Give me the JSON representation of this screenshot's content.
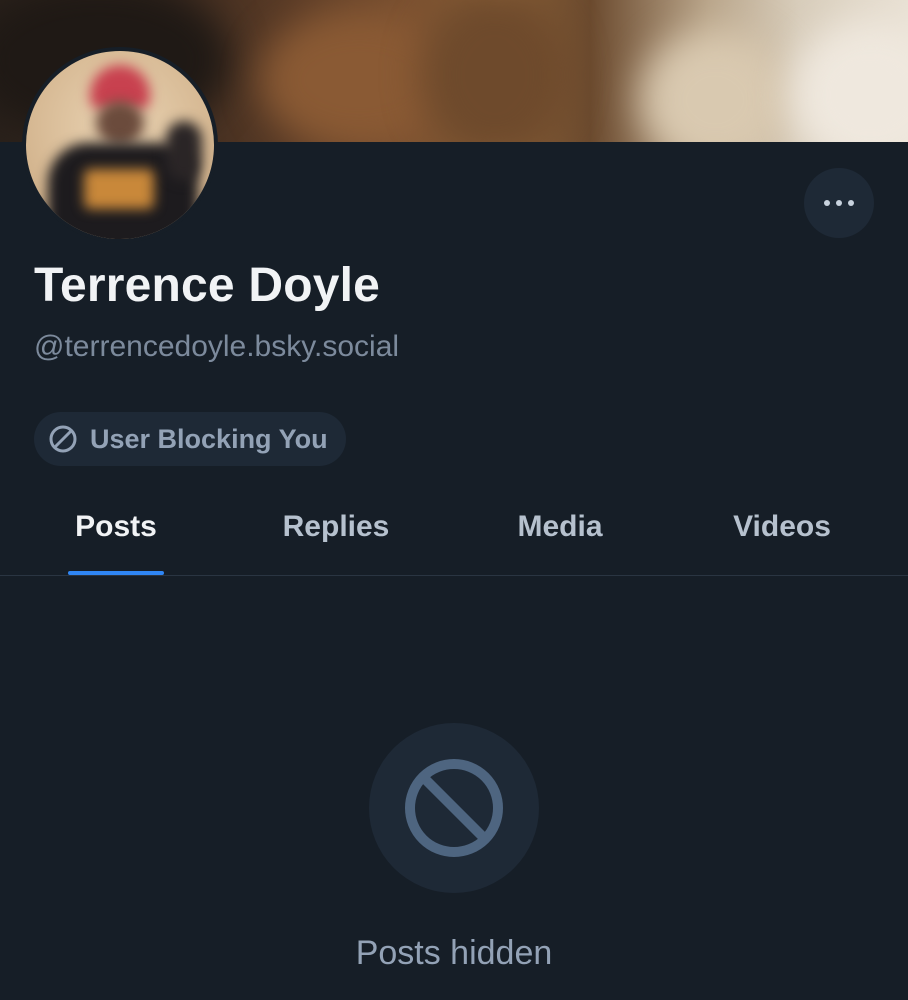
{
  "profile": {
    "display_name": "Terrence Doyle",
    "handle": "@terrencedoyle.bsky.social"
  },
  "block_status": {
    "label": "User Blocking You",
    "icon": "block-icon"
  },
  "more_button": {
    "icon": "ellipsis-icon"
  },
  "tabs": [
    {
      "label": "Posts",
      "active": true
    },
    {
      "label": "Replies",
      "active": false
    },
    {
      "label": "Media",
      "active": false
    },
    {
      "label": "Videos",
      "active": false
    }
  ],
  "empty_state": {
    "icon": "block-icon",
    "message": "Posts hidden"
  },
  "colors": {
    "background": "#161e27",
    "accent": "#2f86f5",
    "muted_text": "#93a2b6",
    "surface": "#1e2936"
  }
}
